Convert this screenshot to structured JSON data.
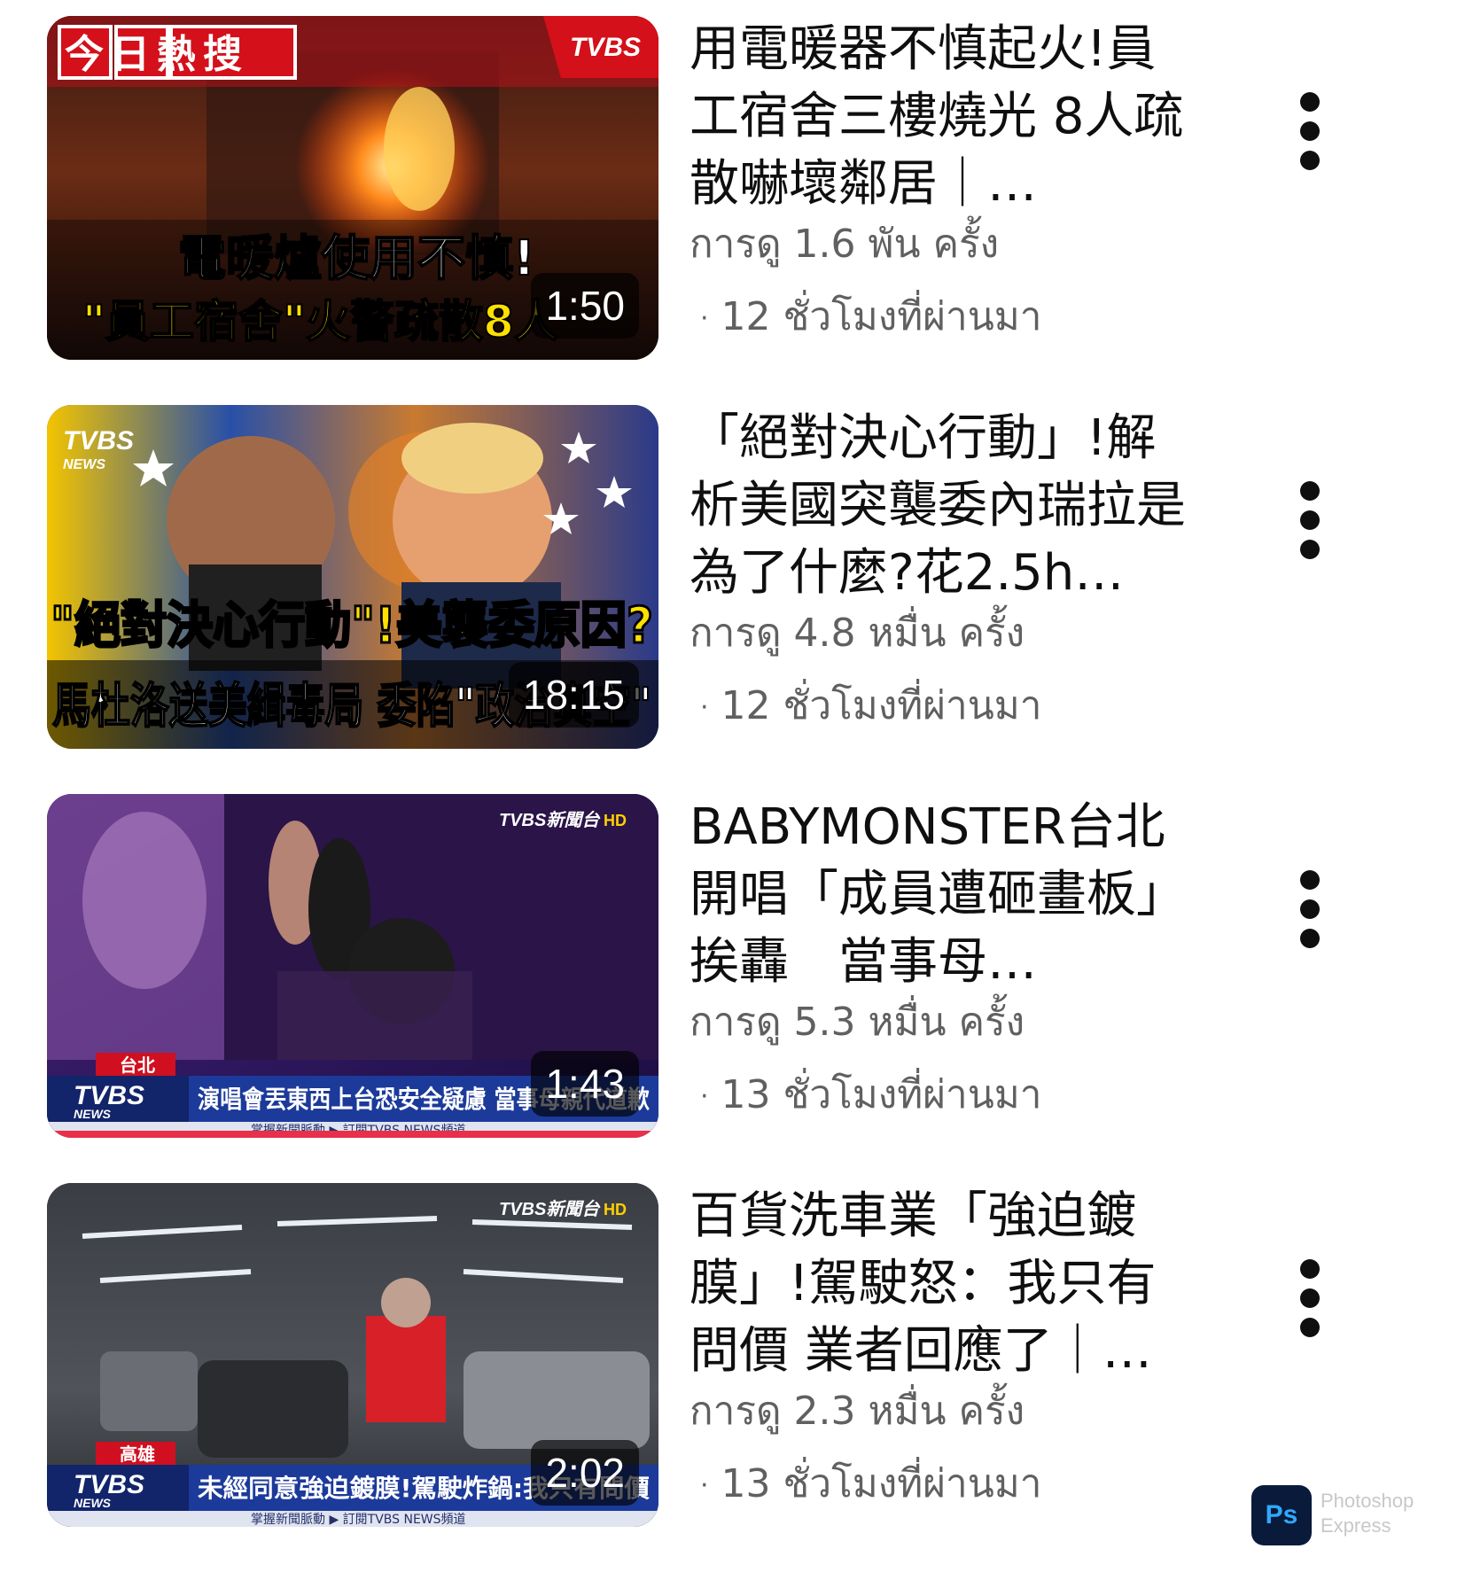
{
  "videos": [
    {
      "title": "用電暖器不慎起火!員工宿舍三樓燒光 8人疏散嚇壞鄰居｜…",
      "views": "การดู 1.6 พัน ครั้ง",
      "age": "12 ชั่วโมงที่ผ่านมา",
      "duration": "1:50",
      "thumb": {
        "badge": "今日熱搜",
        "logo": "TVBS",
        "line1": "電暖爐使用不慎!",
        "line2": "\"員工宿舍\"火警疏散8人"
      }
    },
    {
      "title": "「絕對決心行動」!解析美國突襲委內瑞拉是為了什麼?花2.5h…",
      "views": "การดู 4.8 หมื่น ครั้ง",
      "age": "12 ชั่วโมงที่ผ่านมา",
      "duration": "18:15",
      "thumb": {
        "logo": "TVBS",
        "logo_sub": "NEWS",
        "line1": "\"絕對決心行動\"!美襲委原因?",
        "line2": "馬杜洛送美緝毒局 委陷\"政治真空\""
      }
    },
    {
      "title": "BABYMONSTER台北開唱「成員遭砸畫板」挨轟　當事母…",
      "views": "การดู 5.3 หมื่น ครั้ง",
      "age": "13 ชั่วโมงที่ผ่านมา",
      "duration": "1:43",
      "thumb": {
        "logo": "TVBS新聞台",
        "hd": "HD",
        "location": "台北",
        "ticker_logo": "TVBS",
        "ticker_sub": "NEWS",
        "ticker": "演唱會丟東西上台恐安全疑慮 當事母親代道歉",
        "sub_ticker": "掌握新聞脈動 ▶ 訂閱TVBS NEWS頻道"
      }
    },
    {
      "title": "百貨洗車業「強迫鍍膜」!駕駛怒：我只有問價 業者回應了｜…",
      "views": "การดู 2.3 หมื่น ครั้ง",
      "age": "13 ชั่วโมงที่ผ่านมา",
      "duration": "2:02",
      "thumb": {
        "logo": "TVBS新聞台",
        "hd": "HD",
        "location": "高雄",
        "ticker_logo": "TVBS",
        "ticker_sub": "NEWS",
        "ticker": "未經同意強迫鍍膜!駕駛炸鍋:我只有問價",
        "sub_ticker": "掌握新聞脈動 ▶ 訂閱TVBS NEWS頻道"
      }
    }
  ],
  "watermark": {
    "icon": "Ps",
    "text": "Photoshop\nExpress"
  }
}
